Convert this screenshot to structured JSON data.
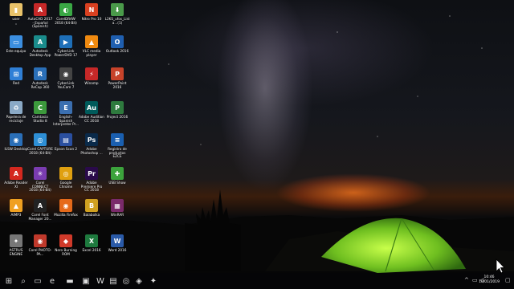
{
  "desktop": {
    "icons": [
      {
        "label": "user",
        "color": "#e8c26a",
        "glyph": "▮",
        "col": 0,
        "row": 0
      },
      {
        "label": "Este equipo",
        "color": "#3b8ee0",
        "glyph": "▭",
        "col": 0,
        "row": 1
      },
      {
        "label": "Red",
        "color": "#2f7fd6",
        "glyph": "⊞",
        "col": 0,
        "row": 2
      },
      {
        "label": "Papelera de reciclaje",
        "color": "#8aa9c6",
        "glyph": "♻",
        "col": 0,
        "row": 3
      },
      {
        "label": "ILSW Desktop",
        "color": "#2a6fb8",
        "glyph": "◉",
        "col": 0,
        "row": 4
      },
      {
        "label": "Adobe Reader XI",
        "color": "#d4281f",
        "glyph": "A",
        "col": 0,
        "row": 5
      },
      {
        "label": "AIMP3",
        "color": "#f0a020",
        "glyph": "▲",
        "col": 0,
        "row": 6
      },
      {
        "label": "ASTRUS ENGINE",
        "color": "#777777",
        "glyph": "✦",
        "col": 0,
        "row": 7
      },
      {
        "label": "AutoCAD 2017 - Español (Spanish)",
        "color": "#c62828",
        "glyph": "A",
        "col": 1,
        "row": 0
      },
      {
        "label": "Autodesk Desktop App",
        "color": "#1a8c8c",
        "glyph": "A",
        "col": 1,
        "row": 1
      },
      {
        "label": "Autodesk ReCap 360",
        "color": "#2a6fb8",
        "glyph": "R",
        "col": 1,
        "row": 2
      },
      {
        "label": "Camtasia Studio 8",
        "color": "#3c9a3c",
        "glyph": "C",
        "col": 1,
        "row": 3
      },
      {
        "label": "Corel CAPTURE 2018 (64-Bit)",
        "color": "#2d8fd6",
        "glyph": "◎",
        "col": 1,
        "row": 4
      },
      {
        "label": "Corel CONNECT 2018 (64-Bit)",
        "color": "#7a3cb0",
        "glyph": "✳",
        "col": 1,
        "row": 5
      },
      {
        "label": "Corel Font Manager 20...",
        "color": "#222222",
        "glyph": "A",
        "col": 1,
        "row": 6
      },
      {
        "label": "Corel PHOTO-PA...",
        "color": "#c0392b",
        "glyph": "◉",
        "col": 1,
        "row": 7
      },
      {
        "label": "CorelDRAW 2018 (64-Bit)",
        "color": "#3aa845",
        "glyph": "◐",
        "col": 2,
        "row": 0
      },
      {
        "label": "CyberLink PowerDVD 17",
        "color": "#1e6fb8",
        "glyph": "▶",
        "col": 2,
        "row": 1
      },
      {
        "label": "CyberLink YouCam 7",
        "color": "#444444",
        "glyph": "◉",
        "col": 2,
        "row": 2
      },
      {
        "label": "English-Spanish Interpreter Pr...",
        "color": "#3b6fb0",
        "glyph": "E",
        "col": 2,
        "row": 3
      },
      {
        "label": "Epson Scan 2",
        "color": "#2a4fa0",
        "glyph": "▤",
        "col": 2,
        "row": 4
      },
      {
        "label": "Google Chrome",
        "color": "#e0a010",
        "glyph": "◎",
        "col": 2,
        "row": 5
      },
      {
        "label": "Mozilla Firefox",
        "color": "#e66a1a",
        "glyph": "◉",
        "col": 2,
        "row": 6
      },
      {
        "label": "Nero Burning ROM",
        "color": "#d03a2a",
        "glyph": "◆",
        "col": 2,
        "row": 7
      },
      {
        "label": "Nitro Pro 10",
        "color": "#d94020",
        "glyph": "N",
        "col": 3,
        "row": 0
      },
      {
        "label": "VLC media player",
        "color": "#f08a10",
        "glyph": "▲",
        "col": 3,
        "row": 1
      },
      {
        "label": "Winamp",
        "color": "#c62828",
        "glyph": "⚡",
        "col": 3,
        "row": 2
      },
      {
        "label": "Adobe Audition CC 2018",
        "color": "#005b5b",
        "glyph": "Au",
        "col": 3,
        "row": 3
      },
      {
        "label": "Adobe Photoshop ...",
        "color": "#0a2a4a",
        "glyph": "Ps",
        "col": 3,
        "row": 4
      },
      {
        "label": "Adobe Premiere Pro CC 2018",
        "color": "#2a0a4a",
        "glyph": "Pr",
        "col": 3,
        "row": 5
      },
      {
        "label": "Balabolka",
        "color": "#d0a020",
        "glyph": "B",
        "col": 3,
        "row": 6
      },
      {
        "label": "Excel 2016",
        "color": "#1e7a3e",
        "glyph": "X",
        "col": 3,
        "row": 7
      },
      {
        "label": "L2KS_ufos_Lista...(1)",
        "color": "#4a9a4a",
        "glyph": "⬇",
        "col": 4,
        "row": 0
      },
      {
        "label": "Outlook 2016",
        "color": "#1f5fb0",
        "glyph": "O",
        "col": 4,
        "row": 1
      },
      {
        "label": "PowerPoint 2016",
        "color": "#c7432a",
        "glyph": "P",
        "col": 4,
        "row": 2
      },
      {
        "label": "Project 2016",
        "color": "#2e7a3e",
        "glyph": "P",
        "col": 4,
        "row": 3
      },
      {
        "label": "Registro de productos EZCE",
        "color": "#1a5fb0",
        "glyph": "≡",
        "col": 4,
        "row": 4
      },
      {
        "label": "USB Show",
        "color": "#3ca33c",
        "glyph": "✚",
        "col": 4,
        "row": 5
      },
      {
        "label": "WinRAR",
        "color": "#7a2a6a",
        "glyph": "▦",
        "col": 4,
        "row": 6
      },
      {
        "label": "Word 2016",
        "color": "#2a5aa8",
        "glyph": "W",
        "col": 4,
        "row": 7
      }
    ]
  },
  "taskbar": {
    "items": [
      {
        "name": "start-icon",
        "glyph": "⊞"
      },
      {
        "name": "search-icon",
        "glyph": "⌕"
      },
      {
        "name": "task-view-icon",
        "glyph": "▭"
      },
      {
        "name": "edge-icon",
        "glyph": "e"
      },
      {
        "name": "file-explorer-icon",
        "glyph": "▬"
      },
      {
        "name": "store-icon",
        "glyph": "▣"
      },
      {
        "name": "word-icon",
        "glyph": "W"
      },
      {
        "name": "app-icon",
        "glyph": "▤"
      },
      {
        "name": "chrome-icon",
        "glyph": "◎"
      },
      {
        "name": "app2-icon",
        "glyph": "◈"
      },
      {
        "name": "app3-icon",
        "glyph": "✦"
      }
    ],
    "time": "10:46",
    "date": "10/01/2019"
  }
}
